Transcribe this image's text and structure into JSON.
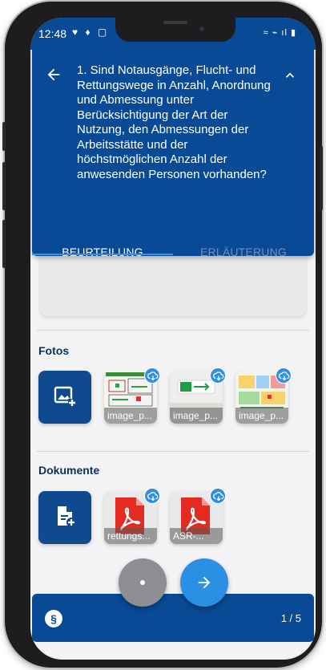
{
  "status_bar": {
    "time": "12:48",
    "left_icons": "♥ ♦ ▢",
    "right_icons": "≈ ⌁ ıl ▮"
  },
  "header": {
    "question": "1. Sind Notausgänge, Flucht- und Rettungswege in Anzahl, Anordnung und Abmessung unter Berücksichtigung der Art der Nutzung, den Abmessungen der Arbeitsstätte und der höchstmöglichen Anzahl der anwesenden Personen vorhanden?",
    "tabs": [
      {
        "label": "BEURTEILUNG",
        "active": true
      },
      {
        "label": "ERLÄUTERUNG",
        "active": false
      }
    ]
  },
  "photos": {
    "title": "Fotos",
    "items": [
      {
        "label": "image_p..."
      },
      {
        "label": "image_p..."
      },
      {
        "label": "image_p..."
      }
    ]
  },
  "documents": {
    "title": "Dokumente",
    "items": [
      {
        "label": "rettungs..."
      },
      {
        "label": "ASR-..."
      }
    ]
  },
  "footer": {
    "paragraph_icon": "§",
    "page_counter": "1 / 5"
  },
  "colors": {
    "primary": "#084a96",
    "accent": "#2b8fe4",
    "tab_inactive": "#6f8fbd",
    "section_title": "#0b2f5c",
    "pdf_red": "#e32b22"
  },
  "icons": {
    "back": "arrow-left-icon",
    "collapse": "chevron-up-icon",
    "add_photo": "add-photo-icon",
    "add_document": "add-document-icon",
    "download": "download-icon",
    "pdf": "pdf-icon",
    "next": "arrow-right-icon",
    "paragraph": "paragraph-icon"
  }
}
